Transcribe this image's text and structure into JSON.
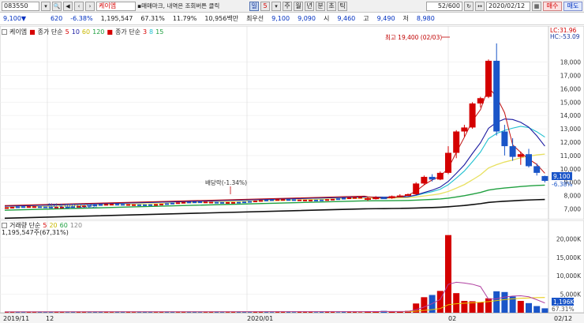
{
  "toolbar": {
    "code": "083550",
    "name": "케이엠",
    "notice": "▪매매마크, 내역은 조회버튼 클릭",
    "periods": [
      "일",
      "5",
      "주",
      "월",
      "년",
      "분",
      "초",
      "틱"
    ],
    "count": "52/600",
    "date": "2020/02/12",
    "buy": "매수",
    "sell": "매도"
  },
  "quote": {
    "price": "9,100",
    "change": "620",
    "change_pct": "-6.38%",
    "volume": "1,195,547",
    "vol_ratio": "67.31%",
    "turnover": "11.79%",
    "amount": "10,956백만",
    "best_label": "최우선",
    "best_ask": "9,100",
    "best_bid": "9,090",
    "open_label": "시",
    "open": "9,460",
    "high_label": "고",
    "high": "9,490",
    "low_label": "저",
    "low": "8,980"
  },
  "price_pane": {
    "legend_name": "케이엠",
    "legend_ma_label": "종가 단순",
    "legend_ma_periods": [
      "5",
      "10",
      "60",
      "120"
    ],
    "legend_ma2_label": "종가 단순",
    "legend_ma2_periods": [
      "3",
      "8",
      "15"
    ],
    "lc": "LC:31.96",
    "hc": "HC:-53.09",
    "annotation_high": "최고 19,400 (02/03)",
    "annotation_dividend": "배당락(-1.34%)",
    "annotation_low": "최저 4,010 (11/29)",
    "current_price_tag": "9,100",
    "current_pct_tag": "-6.38%",
    "y_ticks": [
      "18,000",
      "17,000",
      "16,000",
      "15,000",
      "14,000",
      "13,000",
      "12,000",
      "11,000",
      "10,000",
      "9,000",
      "8,000",
      "7,000"
    ]
  },
  "volume_pane": {
    "legend_label": "거래량 단순",
    "legend_periods": [
      "5",
      "20",
      "60",
      "120"
    ],
    "volume_value": "1,195,547주(67,31%)",
    "current_tag": "1,196K",
    "current_pct": "67.31%",
    "y_ticks": [
      "20,000K",
      "15,000K",
      "10,000K",
      "5,000K"
    ]
  },
  "date_axis": {
    "labels": [
      "2019/11",
      "12",
      "2020/01",
      "02",
      "02/12"
    ]
  },
  "colors": {
    "up": "#d40000",
    "down": "#1a55c8",
    "ma5": "#c01010",
    "ma10": "#1a1aa0",
    "ma20": "#20c0d0",
    "ma60": "#e8e060",
    "ma120": "#20a040",
    "ma_long": "#101010"
  },
  "chart_data": {
    "type": "candlestick",
    "price_min": 6200,
    "price_max": 19400,
    "recent_candles": [
      {
        "o": 7700,
        "h": 7900,
        "l": 7600,
        "c": 7800
      },
      {
        "o": 7800,
        "h": 7950,
        "l": 7700,
        "c": 7850
      },
      {
        "o": 7850,
        "h": 7900,
        "l": 7750,
        "c": 7800
      },
      {
        "o": 7800,
        "h": 8000,
        "l": 7750,
        "c": 7950
      },
      {
        "o": 7950,
        "h": 8100,
        "l": 7900,
        "c": 8000
      },
      {
        "o": 8000,
        "h": 8150,
        "l": 7950,
        "c": 8100
      },
      {
        "o": 8100,
        "h": 9000,
        "l": 8050,
        "c": 8900
      },
      {
        "o": 8900,
        "h": 9500,
        "l": 8800,
        "c": 9400
      },
      {
        "o": 9400,
        "h": 9600,
        "l": 9050,
        "c": 9200
      },
      {
        "o": 9200,
        "h": 9800,
        "l": 9150,
        "c": 9700
      },
      {
        "o": 9700,
        "h": 11700,
        "l": 9600,
        "c": 11200
      },
      {
        "o": 11200,
        "h": 12900,
        "l": 10800,
        "c": 12800
      },
      {
        "o": 12800,
        "h": 13300,
        "l": 12400,
        "c": 13100
      },
      {
        "o": 13100,
        "h": 15000,
        "l": 13000,
        "c": 14900
      },
      {
        "o": 14900,
        "h": 15400,
        "l": 14600,
        "c": 15300
      },
      {
        "o": 15400,
        "h": 18200,
        "l": 15300,
        "c": 18100
      },
      {
        "o": 18100,
        "h": 19400,
        "l": 12500,
        "c": 12800
      },
      {
        "o": 12800,
        "h": 13300,
        "l": 11000,
        "c": 11700
      },
      {
        "o": 11700,
        "h": 12300,
        "l": 10600,
        "c": 10900
      },
      {
        "o": 10900,
        "h": 11300,
        "l": 10300,
        "c": 11100
      },
      {
        "o": 11100,
        "h": 11500,
        "l": 10100,
        "c": 10200
      },
      {
        "o": 10200,
        "h": 10400,
        "l": 9500,
        "c": 9700
      },
      {
        "o": 9460,
        "h": 9490,
        "l": 8980,
        "c": 9100
      }
    ],
    "volume_bars_k": [
      400,
      300,
      500,
      250,
      300,
      500,
      2500,
      4200,
      4800,
      5900,
      21000,
      5300,
      3200,
      3100,
      2800,
      3900,
      5800,
      5600,
      4400,
      3200,
      2600,
      1800,
      1196
    ],
    "volume_ylim": [
      0,
      22000
    ]
  }
}
